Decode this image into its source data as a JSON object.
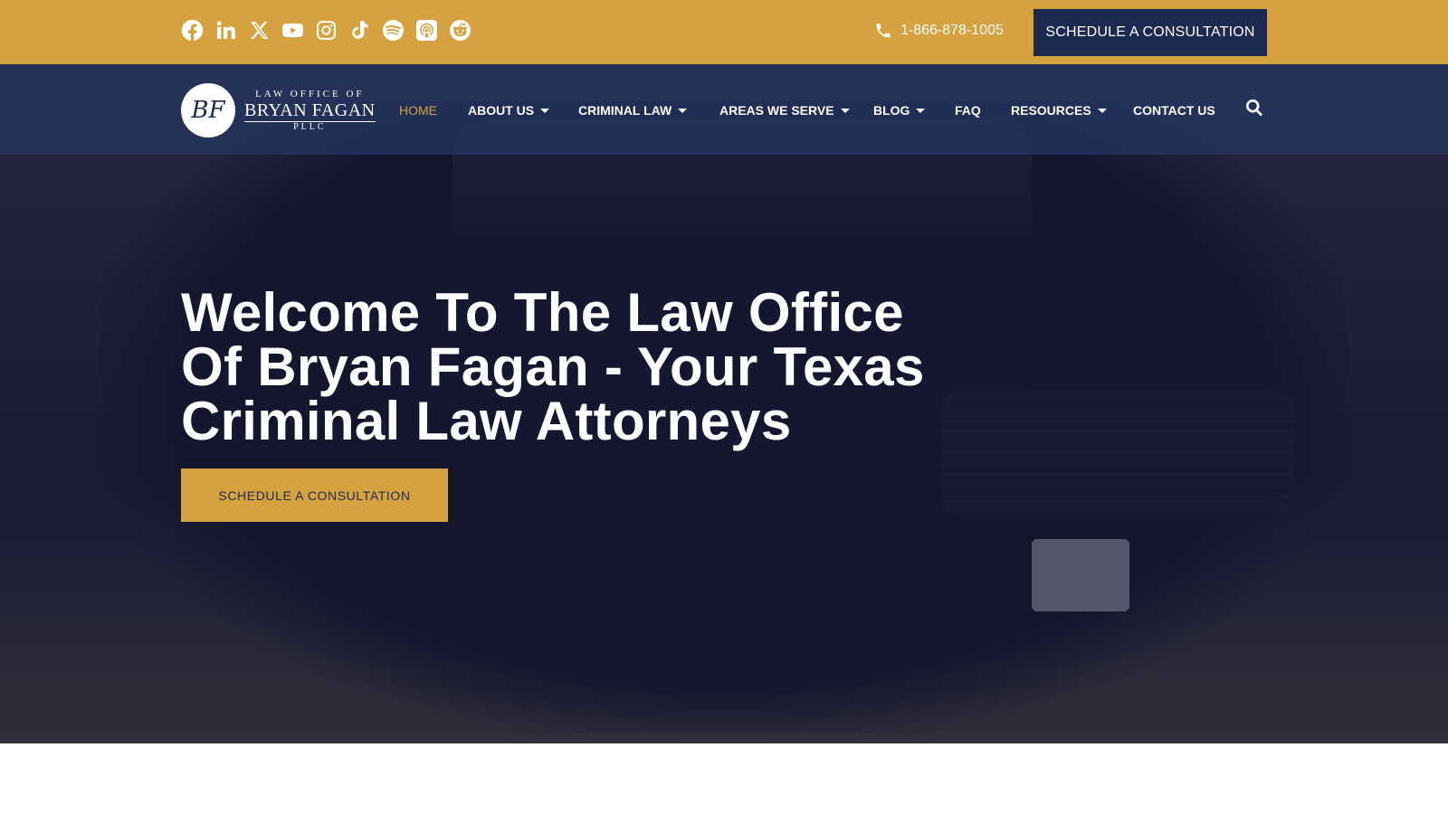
{
  "topbar": {
    "social": [
      "facebook-icon",
      "linkedin-icon",
      "x-twitter-icon",
      "youtube-icon",
      "instagram-icon",
      "tiktok-icon",
      "spotify-icon",
      "podcasts-icon",
      "reddit-icon"
    ],
    "phone": "1-866-878-1005",
    "cta_label": "SCHEDULE A CONSULTATION"
  },
  "logo": {
    "monogram": "BF",
    "line1": "LAW OFFICE OF",
    "line2": "BRYAN FAGAN",
    "line3": "PLLC"
  },
  "nav": {
    "items": [
      {
        "label": "HOME",
        "active": true,
        "dropdown": false
      },
      {
        "label": "ABOUT US",
        "active": false,
        "dropdown": true
      },
      {
        "label": "CRIMINAL LAW",
        "active": false,
        "dropdown": true
      },
      {
        "label": "AREAS WE SERVE",
        "active": false,
        "dropdown": true
      },
      {
        "label": "BLOG",
        "active": false,
        "dropdown": true
      },
      {
        "label": "FAQ",
        "active": false,
        "dropdown": false
      },
      {
        "label": "RESOURCES",
        "active": false,
        "dropdown": true
      },
      {
        "label": "CONTACT US",
        "active": false,
        "dropdown": false
      }
    ]
  },
  "hero": {
    "headline": "Welcome To The Law Office Of Bryan Fagan - Your Texas Criminal Law Attorneys",
    "cta_label": "SCHEDULE A CONSULTATION"
  },
  "colors": {
    "gold": "#d6a23f",
    "navy": "#1c2a52",
    "white": "#ffffff"
  }
}
